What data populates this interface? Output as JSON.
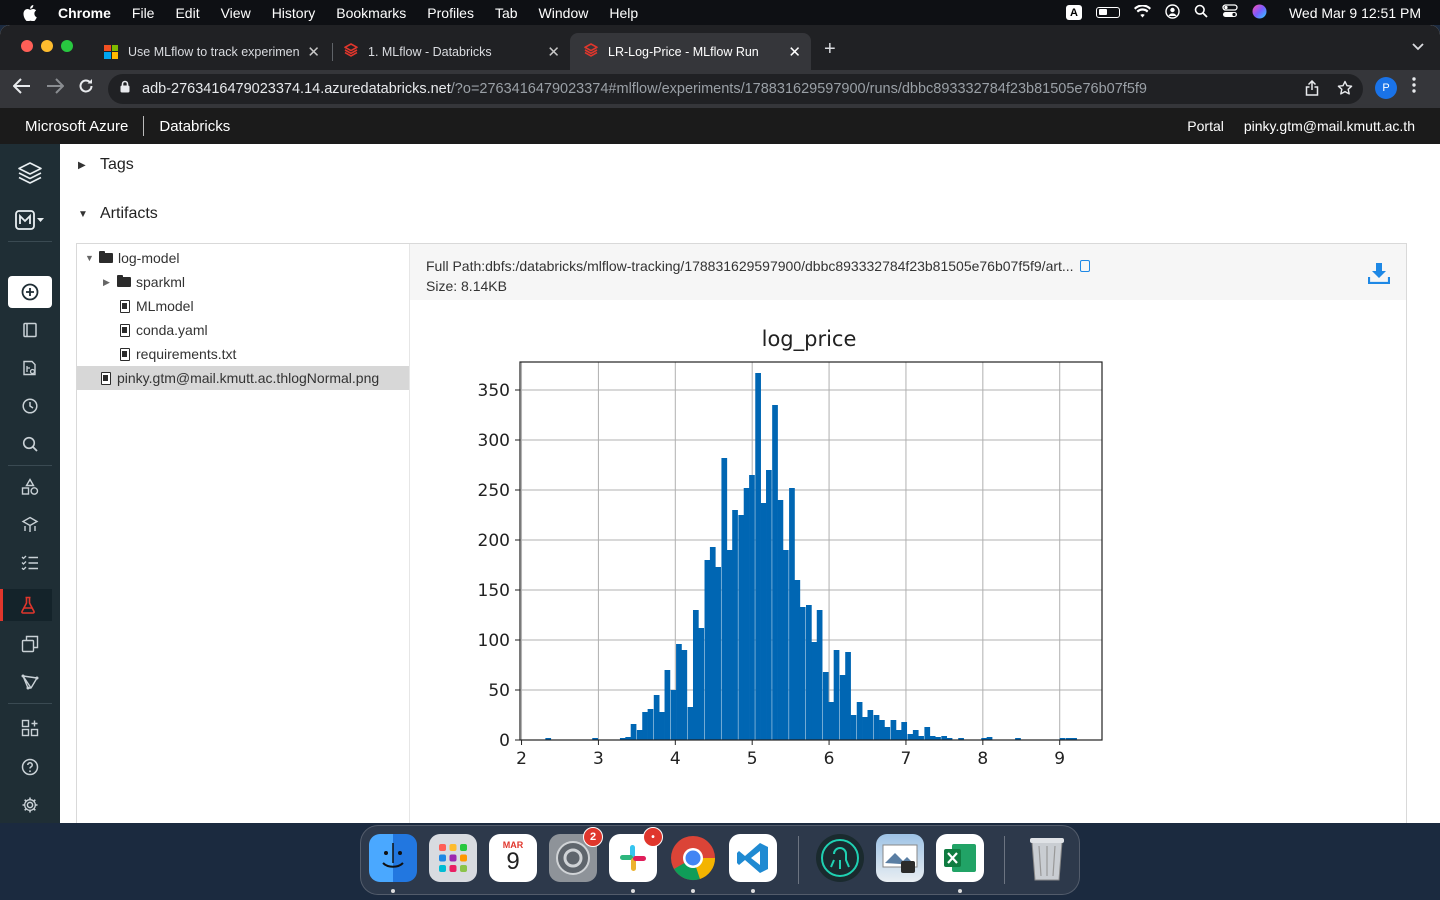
{
  "menubar": {
    "app": "Chrome",
    "items": [
      "File",
      "Edit",
      "View",
      "History",
      "Bookmarks",
      "Profiles",
      "Tab",
      "Window",
      "Help"
    ],
    "input_source": "A",
    "clock": "Wed Mar 9  12:51 PM"
  },
  "tabs": [
    {
      "title": "Use MLflow to track experimen",
      "icon": "microsoft-icon"
    },
    {
      "title": "1. MLflow - Databricks",
      "icon": "databricks-icon"
    },
    {
      "title": "LR-Log-Price - MLflow Run",
      "icon": "databricks-icon",
      "active": true
    }
  ],
  "address": {
    "host": "adb-2763416479023374.14.azuredatabricks.net",
    "path": "/?o=2763416479023374#mlflow/experiments/178831629597900/runs/dbbc893332784f23b81505e76b07f5f9",
    "profile_initial": "P"
  },
  "header": {
    "brand": "Microsoft Azure",
    "product": "Databricks",
    "portal": "Portal",
    "user": "pinky.gtm@mail.kmutt.ac.th"
  },
  "sections": {
    "tags": "Tags",
    "artifacts": "Artifacts"
  },
  "tree": {
    "root": "log-model",
    "sparkml": "sparkml",
    "mlmodel": "MLmodel",
    "conda": "conda.yaml",
    "requirements": "requirements.txt",
    "selected": "pinky.gtm@mail.kmutt.ac.thlogNormal.png"
  },
  "preview": {
    "full_path": "Full Path:dbfs:/databricks/mlflow-tracking/178831629597900/dbbc893332784f23b81505e76b07f5f9/art...",
    "size": "Size: 8.14KB"
  },
  "chart_data": {
    "type": "bar",
    "title": "log_price",
    "xlabel": "",
    "ylabel": "",
    "xlim": [
      1.98,
      9.55
    ],
    "ylim": [
      0,
      378
    ],
    "xticks": [
      2,
      3,
      4,
      5,
      6,
      7,
      8,
      9
    ],
    "yticks": [
      0,
      50,
      100,
      150,
      200,
      250,
      300,
      350
    ],
    "grid": true,
    "color": "#0066b3",
    "bin_width": 0.0742,
    "bins": [
      [
        2.31,
        2
      ],
      [
        2.92,
        2
      ],
      [
        3.28,
        2
      ],
      [
        3.35,
        3
      ],
      [
        3.42,
        16
      ],
      [
        3.5,
        10
      ],
      [
        3.57,
        28
      ],
      [
        3.64,
        31
      ],
      [
        3.72,
        45
      ],
      [
        3.79,
        28
      ],
      [
        3.86,
        70
      ],
      [
        3.94,
        50
      ],
      [
        4.01,
        96
      ],
      [
        4.08,
        90
      ],
      [
        4.16,
        33
      ],
      [
        4.23,
        130
      ],
      [
        4.3,
        112
      ],
      [
        4.38,
        180
      ],
      [
        4.45,
        193
      ],
      [
        4.52,
        173
      ],
      [
        4.6,
        282
      ],
      [
        4.67,
        190
      ],
      [
        4.74,
        230
      ],
      [
        4.82,
        225
      ],
      [
        4.89,
        252
      ],
      [
        4.96,
        265
      ],
      [
        5.04,
        367
      ],
      [
        5.11,
        237
      ],
      [
        5.18,
        270
      ],
      [
        5.26,
        335
      ],
      [
        5.33,
        240
      ],
      [
        5.4,
        190
      ],
      [
        5.48,
        252
      ],
      [
        5.55,
        160
      ],
      [
        5.62,
        133
      ],
      [
        5.7,
        135
      ],
      [
        5.77,
        98
      ],
      [
        5.84,
        130
      ],
      [
        5.92,
        68
      ],
      [
        5.99,
        38
      ],
      [
        6.06,
        90
      ],
      [
        6.14,
        65
      ],
      [
        6.21,
        88
      ],
      [
        6.28,
        25
      ],
      [
        6.36,
        38
      ],
      [
        6.43,
        23
      ],
      [
        6.5,
        30
      ],
      [
        6.58,
        25
      ],
      [
        6.65,
        20
      ],
      [
        6.72,
        13
      ],
      [
        6.8,
        20
      ],
      [
        6.87,
        10
      ],
      [
        6.94,
        18
      ],
      [
        7.02,
        6
      ],
      [
        7.09,
        10
      ],
      [
        7.16,
        4
      ],
      [
        7.24,
        13
      ],
      [
        7.31,
        4
      ],
      [
        7.38,
        3
      ],
      [
        7.46,
        4
      ],
      [
        7.53,
        2
      ],
      [
        7.68,
        2
      ],
      [
        7.98,
        2
      ],
      [
        8.05,
        3
      ],
      [
        8.42,
        2
      ],
      [
        9.0,
        2
      ],
      [
        9.08,
        2
      ],
      [
        9.15,
        2
      ]
    ]
  },
  "dock": {
    "calendar_month": "MAR",
    "calendar_day": "9",
    "settings_badge": "2",
    "slack_badge": "•"
  }
}
